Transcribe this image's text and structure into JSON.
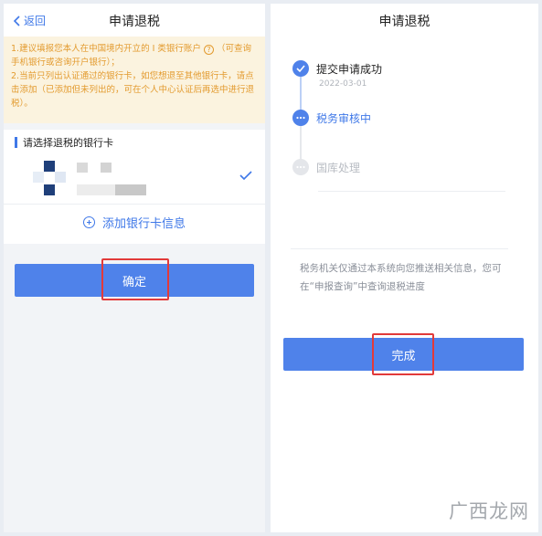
{
  "left": {
    "back_label": "返回",
    "title": "申请退税",
    "notice": {
      "line1a": "1.建议填报您本人在中国境内开立的 I 类银行账户",
      "help_icon": "?",
      "line1b": "（可查询手机银行或咨询开户银行）；",
      "line2": "2.当前只列出认证通过的银行卡，如您想退至其他银行卡，请点击添加（已添加但未列出的，可在个人中心认证后再选中进行退税）。"
    },
    "section_title": "请选择退税的银行卡",
    "add_card_label": "添加银行卡信息",
    "confirm_label": "确定"
  },
  "right": {
    "title": "申请退税",
    "steps": [
      {
        "label": "提交申请成功",
        "date": "2022-03-01",
        "state": "done"
      },
      {
        "label": "税务审核中",
        "state": "active"
      },
      {
        "label": "国库处理",
        "state": "pending"
      }
    ],
    "message": "税务机关仅通过本系统向您推送相关信息，您可在“申报查询”中查询退税进度",
    "done_label": "完成"
  },
  "watermark": "广西龙网",
  "colors": {
    "accent": "#4f82ea",
    "notice_bg": "#fbf3df",
    "notice_text": "#e39b2f",
    "highlight": "#e23a3a"
  },
  "icons": [
    "back-chevron-icon",
    "help-icon",
    "check-icon",
    "plus-circle-icon",
    "step-check-icon",
    "step-dots-icon"
  ]
}
